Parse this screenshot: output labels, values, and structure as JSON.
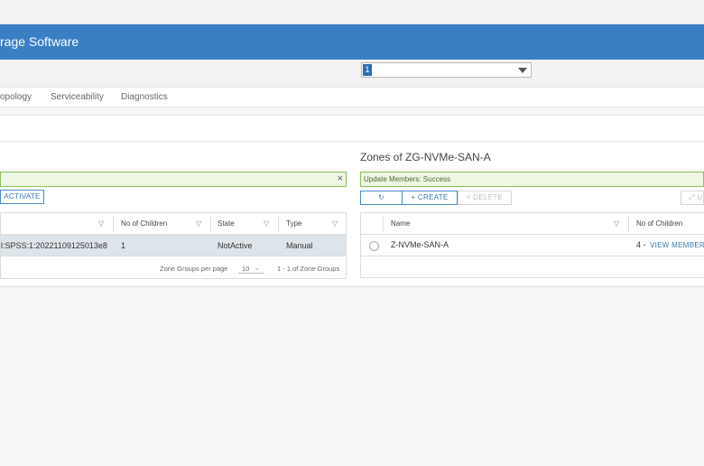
{
  "header": {
    "title": "rage Software"
  },
  "selector": {
    "value": "1"
  },
  "tabs": [
    {
      "label": "opology"
    },
    {
      "label": "Serviceability"
    },
    {
      "label": "Diagnostics"
    }
  ],
  "left_panel": {
    "alert_close": "×",
    "activate_label": "ACTIVATE",
    "columns": [
      "No of Children",
      "State",
      "Type"
    ],
    "rows": [
      {
        "name": "l:SPSS:1:20221109125013e8",
        "children": "1",
        "state": "NotActive",
        "type": "Manual"
      }
    ],
    "footer": {
      "per_page_label": "Zone Groups per page",
      "per_page_value": "10",
      "range": "1 - 1 of Zone Groups"
    }
  },
  "right_panel": {
    "title": "Zones of ZG-NVMe-SAN-A",
    "alert": "Update Members: Success",
    "refresh_label": "↻",
    "create_label": "+  CREATE",
    "delete_label": "×  DELETE",
    "partial_button": "⤢  U",
    "columns": [
      "Name",
      "No of Children"
    ],
    "rows": [
      {
        "name": "Z-NVMe-SAN-A",
        "children": "4 -",
        "link": "VIEW MEMBERS"
      }
    ]
  },
  "icons": {
    "filter": "filter-icon",
    "refresh": "refresh-icon",
    "close": "close-icon",
    "caret": "chevron-down-icon"
  }
}
